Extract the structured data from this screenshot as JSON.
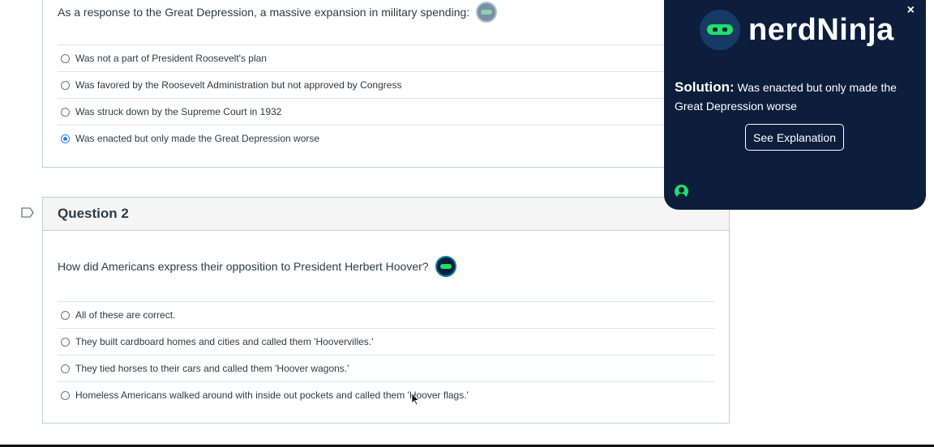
{
  "question1": {
    "text": "As a response to the Great Depression, a massive expansion in military spending:",
    "answers": [
      {
        "label": "Was not a part of President Roosevelt's plan",
        "selected": false
      },
      {
        "label": "Was favored by the Roosevelt Administration but not approved by Congress",
        "selected": false
      },
      {
        "label": "Was struck down by the Supreme Court in 1932",
        "selected": false
      },
      {
        "label": "Was enacted but only made the Great Depression worse",
        "selected": true
      }
    ]
  },
  "question2": {
    "title": "Question 2",
    "text": "How did Americans express their opposition to President Herbert Hoover?",
    "answers": [
      {
        "label": "All of these are correct.",
        "selected": false
      },
      {
        "label": "They built cardboard homes and cities and called them 'Hoovervilles.'",
        "selected": false
      },
      {
        "label": "They tied horses to their cars and called them 'Hoover wagons.'",
        "selected": false
      },
      {
        "label": "Homeless Americans walked around with inside out pockets and called them 'Hoover flags.'",
        "selected": false
      }
    ]
  },
  "popup": {
    "brand": "nerdNinja",
    "close": "×",
    "solution_label": "Solution:",
    "solution_text": "Was enacted but only made the Great Depression worse",
    "explain_button": "See Explanation"
  },
  "colors": {
    "popup_bg": "#0c1e3c",
    "accent_green": "#1fe06a",
    "radio_selected": "#2d7fe0"
  },
  "icons": [
    "nerdninja-badge-icon",
    "flag-icon",
    "close-icon",
    "user-icon",
    "mouse-cursor-icon"
  ]
}
